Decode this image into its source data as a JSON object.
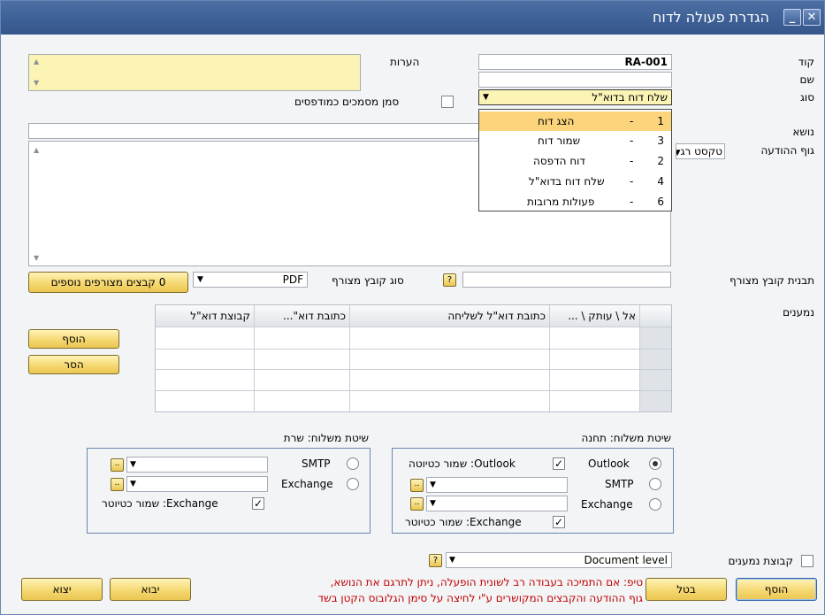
{
  "window": {
    "title": "הגדרת פעולה לדוח"
  },
  "fields": {
    "code_label": "קוד",
    "code_value": "RA-001",
    "name_label": "שם",
    "name_value": "",
    "type_label": "סוג",
    "type_value": "שלח דוח בדוא\"ל",
    "notes_label": "הערות",
    "subject_label": "נושא",
    "body_label": "גוף ההודעה",
    "body_format": "טקסט רג",
    "mark_printed_label": "סמן מסמכים כמודפסים",
    "attach_template_label": "תבנית קובץ מצורף",
    "attach_type_label": "סוג קובץ מצורף",
    "attach_type_value": "PDF",
    "help": "?",
    "more_attach_button": "0 קבצים מצורפים נוספים",
    "recipients_label": "נמענים",
    "recipients_group_label": "קבוצת נמענים",
    "doc_level_value": "Document level"
  },
  "dropdown": {
    "items": [
      {
        "num": "1",
        "dash": "-",
        "label": "הצג דוח"
      },
      {
        "num": "3",
        "dash": "-",
        "label": "שמור דוח"
      },
      {
        "num": "2",
        "dash": "-",
        "label": "דוח הדפסה"
      },
      {
        "num": "4",
        "dash": "-",
        "label": "שלח דוח בדוא\"ל"
      },
      {
        "num": "6",
        "dash": "-",
        "label": "פעולות מרובות"
      }
    ]
  },
  "grid": {
    "columns": [
      "אל \\ עותק \\ ...",
      "כתובת דוא\"ל לשליחה",
      "כתובת דוא\"...",
      "קבוצת דוא\"ל"
    ]
  },
  "buttons": {
    "add_row": "הוסף",
    "remove_row": "הסר",
    "add": "הוסף",
    "cancel": "בטל",
    "import": "יבוא",
    "export": "יצוא",
    "ellipsis": ".."
  },
  "station": {
    "title": "שיטת משלוח: תחנה",
    "outlook": "Outlook",
    "outlook_save": "Outlook: שמור כטיוטה",
    "smtp": "SMTP",
    "exchange": "Exchange",
    "exchange_save": "Exchange: שמור כטיוטר"
  },
  "server": {
    "title": "שיטת משלוח: שרת",
    "smtp": "SMTP",
    "exchange": "Exchange",
    "exchange_save": "Exchange: שמור כטיוטר"
  },
  "tip": {
    "line1": "טיפ: אם התמיכה בעבודה רב לשונית הופעלה, ניתן לתרגם את הנושא,",
    "line2": "גוף ההודעה והקבצים המקושרים ע\"י לחיצה על סימן הגלובוס הקטן בשד"
  }
}
